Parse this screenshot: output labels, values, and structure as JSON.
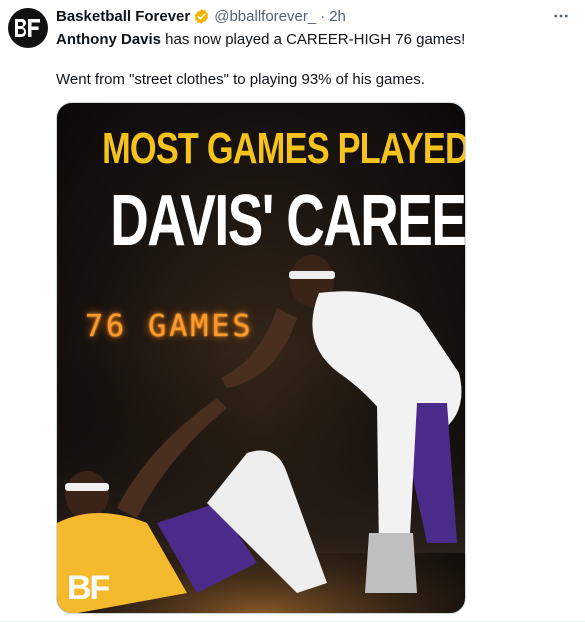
{
  "tweet": {
    "author": {
      "display_name": "Basketball Forever",
      "handle": "@bballforever_",
      "separator": "·",
      "time": "2h",
      "avatar_text": "BF",
      "verified_color": "#f4b400"
    },
    "text": {
      "line1_bold": "Anthony Davis",
      "line1_rest": " has now played a CAREER-HIGH 76 games!",
      "line2": "Went from \"street clothes\" to playing 93% of his games."
    },
    "more_icon": "more-horizontal-icon"
  },
  "media": {
    "headline_top": "MOST GAMES PLAYED IN",
    "headline_bottom": "DAVIS' CAREER",
    "scoreboard": "76 GAMES",
    "watermark": "BF",
    "colors": {
      "headline_top": "#f6c21c",
      "headline_bottom": "#ffffff",
      "scoreboard": "#ff9a2a",
      "lakers_gold": "#f5b92e",
      "lakers_purple": "#4a2b8a",
      "white_jersey": "#f2f2f2"
    }
  }
}
